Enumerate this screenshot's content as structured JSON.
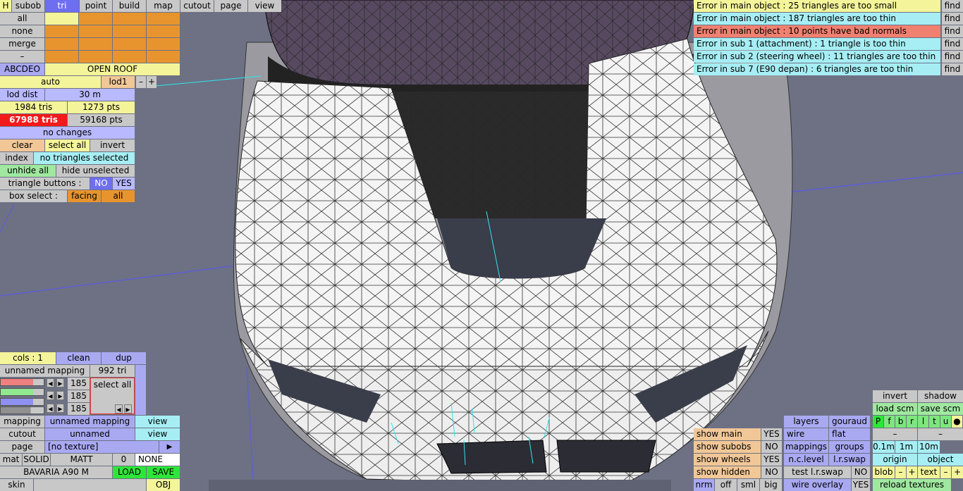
{
  "top_tabs": [
    "H",
    "subob",
    "tri",
    "point",
    "build",
    "map",
    "cutout",
    "page",
    "view"
  ],
  "left_panel": {
    "all": "all",
    "none": "none",
    "merge": "merge",
    "minus": "–",
    "layers_code": "ABCDEO",
    "object_name": "OPEN ROOF",
    "auto": "auto",
    "lod": "lod1",
    "lod_minus": "–",
    "lod_plus": "+",
    "lod_dist_label": "lod dist",
    "lod_dist_value": "30 m",
    "tris": "1984 tris",
    "pts": "1273 pts",
    "total_tris": "67988 tris",
    "total_pts": "59168 pts",
    "status": "no changes",
    "clear": "clear",
    "select_all": "select all",
    "invert": "invert",
    "index": "index",
    "selection_info": "no triangles selected",
    "unhide_all": "unhide all",
    "hide_unselected": "hide unselected",
    "triangle_buttons": "triangle buttons :",
    "no": "NO",
    "yes": "YES",
    "box_select": "box select :",
    "facing": "facing",
    "box_all": "all"
  },
  "errors": [
    {
      "text": "Error in main object : 25 triangles are too small",
      "color": "#f4f49a",
      "find": "find"
    },
    {
      "text": "Error in main object : 187 triangles are too thin",
      "color": "#a6eef4",
      "find": "find"
    },
    {
      "text": "Error in main object : 10 points have bad normals",
      "color": "#f08070",
      "find": "find"
    },
    {
      "text": "Error in sub 1 (attachment) : 1 triangle is too thin",
      "color": "#a6eef4",
      "find": "find"
    },
    {
      "text": "Error in sub 2 (steering wheel) : 11 triangles are too thin",
      "color": "#a6eef4",
      "find": "find"
    },
    {
      "text": "Error in sub 7 (E90 depan) : 6 triangles are too thin",
      "color": "#a6eef4",
      "find": "find"
    }
  ],
  "material_panel": {
    "cols": "cols : 1",
    "clean": "clean",
    "dup": "dup",
    "mapping_name": "unnamed mapping",
    "tri_count": "992 tri",
    "r": "185",
    "g": "185",
    "b": "185",
    "select_all": "select all",
    "mapping_label": "mapping",
    "mapping_value": "unnamed mapping",
    "view1": "view",
    "cutout_label": "cutout",
    "cutout_value": "unnamed",
    "view2": "view",
    "page_label": "page",
    "page_value": "[no texture]",
    "page_arrow": "▶",
    "mat": "mat",
    "solid": "SOLID",
    "matt": "MATT",
    "zero": "0",
    "none": "NONE",
    "material_name": "BAVARIA A90 M",
    "load": "LOAD",
    "save": "SAVE",
    "skin": "skin",
    "obj": "OBJ"
  },
  "right_panel": {
    "invert": "invert",
    "shadow": "shadow",
    "load_scm": "load scm",
    "save_scm": "save scm",
    "letters": [
      "P",
      "f",
      "b",
      "r",
      "l",
      "t",
      "u",
      "●"
    ],
    "minus1": "–",
    "minus2": "–",
    "show_main": "show main",
    "show_main_v": "YES",
    "show_subobs": "show subobs",
    "show_subobs_v": "NO",
    "show_wheels": "show wheels",
    "show_wheels_v": "YES",
    "show_hidden": "show hidden",
    "show_hidden_v": "NO",
    "nrm": "nrm",
    "off": "off",
    "sml": "sml",
    "big": "big",
    "layers": "layers",
    "gouraud": "gouraud",
    "wire": "wire",
    "flat": "flat",
    "mappings": "mappings",
    "groups": "groups",
    "nclevel": "n.c.level",
    "lrswap": "l.r.swap",
    "test_lrswap": "test l.r.swap",
    "test_v": "NO",
    "wire_overlay": "wire overlay",
    "wire_overlay_v": "YES",
    "d01": "0.1m",
    "d1": "1m",
    "d10": "10m",
    "origin": "origin",
    "object": "object",
    "blob": "blob",
    "text": "text",
    "pm_minus": "–",
    "pm_plus": "+",
    "reload": "reload textures"
  }
}
